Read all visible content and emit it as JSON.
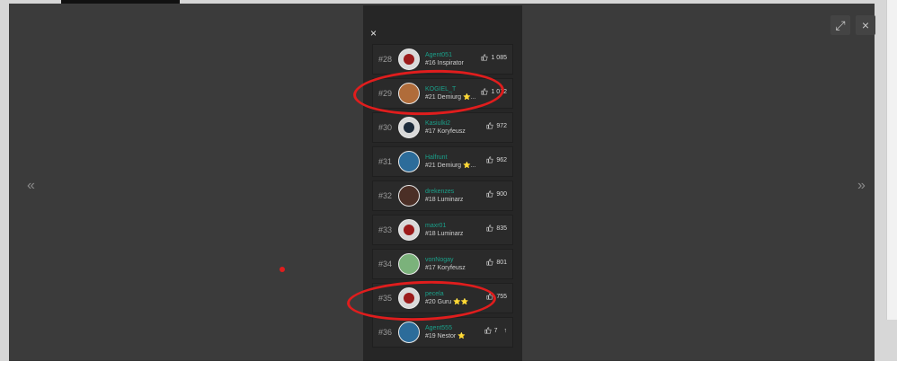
{
  "modal": {
    "close_icon": "×",
    "expand_icon": "⤢",
    "nav_left_icon": "«",
    "nav_right_icon": "»",
    "panel_close_icon": "×"
  },
  "leaderboard": [
    {
      "rank": "#28",
      "name": "Agent051",
      "level": "#16 Inspirator",
      "likes": "1 085"
    },
    {
      "rank": "#29",
      "name": "KOGIEL_T",
      "level": "#21 Demiurg ⭐...",
      "likes": "1 012"
    },
    {
      "rank": "#30",
      "name": "Kasiulki2",
      "level": "#17 Koryfeusz",
      "likes": "972"
    },
    {
      "rank": "#31",
      "name": "Halfrunt",
      "level": "#21 Demiurg ⭐...",
      "likes": "962"
    },
    {
      "rank": "#32",
      "name": "drekenzes",
      "level": "#18 Luminarz",
      "likes": "900"
    },
    {
      "rank": "#33",
      "name": "maxr01",
      "level": "#18 Luminarz",
      "likes": "835"
    },
    {
      "rank": "#34",
      "name": "vonNogay",
      "level": "#17 Koryfeusz",
      "likes": "801"
    },
    {
      "rank": "#35",
      "name": "pecela",
      "level": "#20 Guru ⭐⭐",
      "likes": "755"
    },
    {
      "rank": "#36",
      "name": "Agent555",
      "level": "#19 Nestor ⭐",
      "likes": "7"
    }
  ]
}
